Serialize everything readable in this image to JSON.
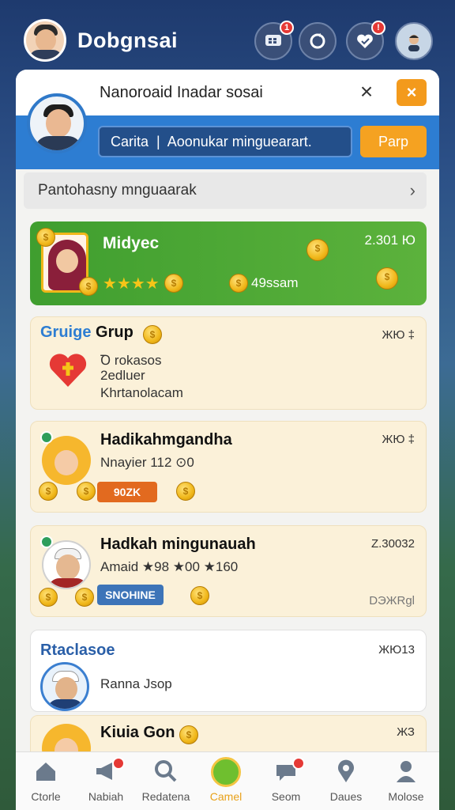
{
  "header": {
    "app_title": "Dobgnsai",
    "icons": [
      {
        "name": "chat-icon",
        "badge": "1"
      },
      {
        "name": "refresh-icon",
        "badge": ""
      },
      {
        "name": "shield-heart-icon",
        "badge": "!"
      },
      {
        "name": "profile-icon",
        "badge": ""
      }
    ]
  },
  "panel": {
    "title": "Nanoroaid Inadar sosai",
    "search": {
      "value": "Carita  |  Aoonukar minguearart.",
      "button_label": "Parp"
    },
    "filter": {
      "label": "Pantohasny mnguaarak",
      "chevron": "›"
    }
  },
  "cards": [
    {
      "type": "featured",
      "name": "Midyec",
      "score": "2.301 Ю",
      "stars": "★★★★",
      "amount": "49ssam"
    },
    {
      "type": "group",
      "title_prefix": "Gruige",
      "title": "Grup",
      "meta": "ЖЮ ‡",
      "line1": "Ꝺ rokasos",
      "line2": "2edluer",
      "line3": "Khrtanolacam"
    },
    {
      "type": "entry",
      "title": "Hadikahmgandha",
      "meta": "ЖЮ ‡",
      "line1": "Nnayier 112 ⊙0",
      "tag": "90ZK"
    },
    {
      "type": "entry",
      "title": "Hadkah mingunauah",
      "meta": "Z.30032",
      "line1": "Amaid ★98 ★00 ★160",
      "tag": "SNOHINE",
      "footer": "DЭЖRgl"
    },
    {
      "type": "release",
      "title": "Rtaclasoe",
      "meta": "ЖЮ13",
      "line1": "Ranna Jsop"
    },
    {
      "type": "entry-partial",
      "title": "Kiuia Gon",
      "meta": "ЖЗ"
    }
  ],
  "bottom_nav": [
    {
      "label": "Ctorle",
      "icon": "home-icon"
    },
    {
      "label": "Nabiah",
      "icon": "megaphone-icon",
      "badge": true
    },
    {
      "label": "Redatena",
      "icon": "search-icon"
    },
    {
      "label": "Camel",
      "icon": "game-icon",
      "active": true
    },
    {
      "label": "Seom",
      "icon": "chat-bubble-icon",
      "badge": true
    },
    {
      "label": "Daues",
      "icon": "location-icon"
    },
    {
      "label": "Molose",
      "icon": "person-icon"
    }
  ],
  "colors": {
    "accent_blue": "#2d7dd2",
    "accent_orange": "#f39a1c",
    "featured_green": "#4aa834",
    "card_cream": "#fbf1d9",
    "nav_active": "#e8a11a"
  }
}
